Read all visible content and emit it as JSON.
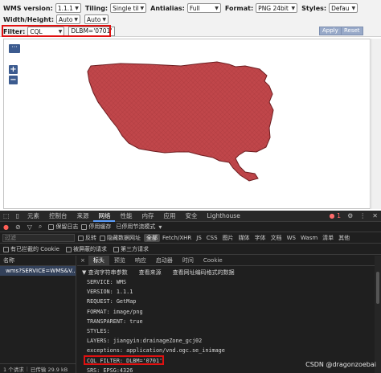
{
  "toolbar": {
    "wms_version_label": "WMS version:",
    "wms_version_value": "1.1.1",
    "tiling_label": "Tiling:",
    "tiling_value": "Single tile",
    "antialias_label": "Antialias:",
    "antialias_value": "Full",
    "format_label": "Format:",
    "format_value": "PNG 24bit",
    "styles_label": "Styles:",
    "styles_value": "Default",
    "width_height_label": "Width/Height:",
    "width_value": "Auto",
    "height_value": "Auto",
    "filter_label": "Filter:",
    "filter_type_value": "CQL",
    "filter_expression": "DLBM='0701'",
    "apply_label": "Apply",
    "reset_label": "Reset"
  },
  "map": {
    "layer_switcher_glyph": "···",
    "zoom_in_glyph": "+",
    "zoom_out_glyph": "−",
    "polygon_fill": "#c0464a"
  },
  "devtools": {
    "tabs": [
      "元素",
      "控制台",
      "来源",
      "网络",
      "性能",
      "内存",
      "应用",
      "安全",
      "Lighthouse"
    ],
    "active_tab": "网络",
    "error_count": "1",
    "toolbar_row": {
      "preserve_log": "保留日志",
      "disable_cache": "停用缓存",
      "throttling": "已停用节流模式"
    },
    "filter_placeholder": "过滤",
    "filter_row": {
      "invert": "反转",
      "hide_data_urls": "隐藏数据网址",
      "types": [
        "全部",
        "Fetch/XHR",
        "JS",
        "CSS",
        "图片",
        "媒体",
        "字体",
        "文档",
        "WS",
        "Wasm",
        "清单",
        "其他"
      ]
    },
    "row4": {
      "blocked_cookies": "有已拦截的 Cookie",
      "blocked_requests": "被屏蔽的请求",
      "third_party": "第三方请求"
    },
    "list_header": "名称",
    "request_name": "wms?SERVICE=WMS&V...",
    "status": {
      "requests": "1 个请求",
      "transferred": "已传输 29.9 kB"
    },
    "detail_tabs": [
      "×",
      "标头",
      "预览",
      "响应",
      "启动器",
      "时间",
      "Cookie"
    ],
    "active_detail_tab": "标头",
    "params_header": {
      "title": "▼ 查询字符串参数",
      "view_source": "查看来源",
      "view_decoded": "查看网址编码格式的数据"
    },
    "params": [
      {
        "key": "SERVICE",
        "value": "WMS"
      },
      {
        "key": "VERSION",
        "value": "1.1.1"
      },
      {
        "key": "REQUEST",
        "value": "GetMap"
      },
      {
        "key": "FORMAT",
        "value": "image/png"
      },
      {
        "key": "TRANSPARENT",
        "value": "true"
      },
      {
        "key": "STYLES",
        "value": ""
      },
      {
        "key": "LAYERS",
        "value": "jiangyin:drainageZone_gcj02"
      },
      {
        "key": "exceptions",
        "value": "application/vnd.ogc.se_inimage"
      },
      {
        "key": "CQL_FILTER",
        "value": "DLBM='0701'"
      },
      {
        "key": "SRS",
        "value": "EPSG:4326"
      }
    ]
  },
  "watermark": "CSDN @dragonzoebai"
}
